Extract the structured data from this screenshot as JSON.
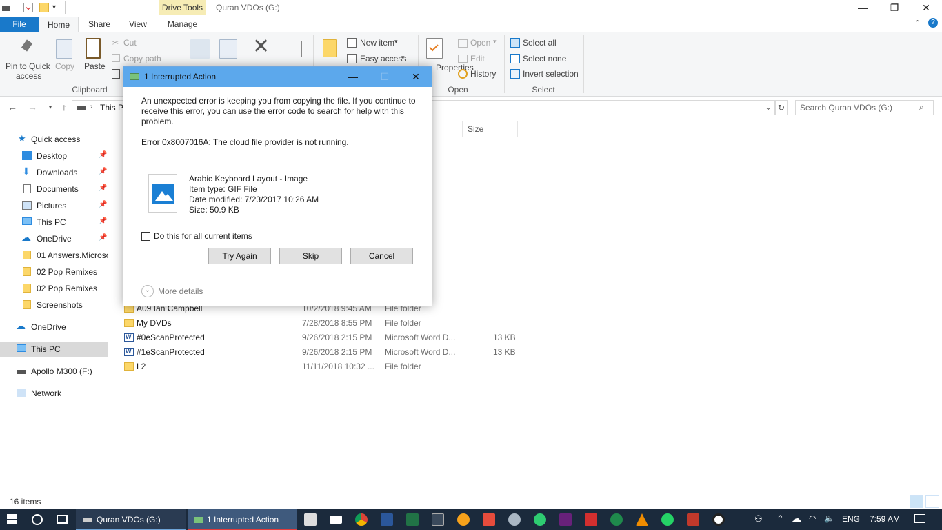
{
  "window": {
    "title": "Quran VDOs (G:)",
    "context_tab": "Drive Tools"
  },
  "tabs": [
    "File",
    "Home",
    "Share",
    "View",
    "Manage"
  ],
  "ribbon": {
    "clipboard": {
      "pin": "Pin to Quick",
      "pin2": "access",
      "copy": "Copy",
      "paste": "Paste",
      "cut": "Cut",
      "copy_path": "Copy path",
      "group": "Clipboard"
    },
    "organize": {
      "move": "Move",
      "copy": "Copy",
      "delete": "Delete",
      "rename": "Rename"
    },
    "new": {
      "new_folder": "New",
      "new_item": "New item",
      "easy_access": "Easy access"
    },
    "open": {
      "properties": "Properties",
      "open": "Open",
      "edit": "Edit",
      "history": "History",
      "group": "Open"
    },
    "select": {
      "select_all": "Select all",
      "select_none": "Select none",
      "invert": "Invert selection",
      "group": "Select"
    }
  },
  "address": {
    "path": "This P",
    "search_placeholder": "Search Quran VDOs (G:)"
  },
  "nav": {
    "quick_access": "Quick access",
    "items": [
      {
        "label": "Desktop"
      },
      {
        "label": "Downloads"
      },
      {
        "label": "Documents"
      },
      {
        "label": "Pictures"
      },
      {
        "label": "This PC"
      },
      {
        "label": "OneDrive"
      },
      {
        "label": "01 Answers.Microsc"
      },
      {
        "label": "02 Pop Remixes"
      },
      {
        "label": "02 Pop Remixes"
      },
      {
        "label": "Screenshots"
      }
    ],
    "onedrive": "OneDrive",
    "this_pc": "This PC",
    "apollo": "Apollo M300 (F:)",
    "network": "Network"
  },
  "filelist": {
    "col_size": "Size",
    "rows": [
      {
        "name": "A09 Ian Campbell",
        "date": "10/2/2018 9:45 AM",
        "type": "File folder",
        "size": ""
      },
      {
        "name": "My DVDs",
        "date": "7/28/2018 8:55 PM",
        "type": "File folder",
        "size": ""
      },
      {
        "name": "#0eScanProtected",
        "date": "9/26/2018 2:15 PM",
        "type": "Microsoft Word D...",
        "size": "13 KB"
      },
      {
        "name": "#1eScanProtected",
        "date": "9/26/2018 2:15 PM",
        "type": "Microsoft Word D...",
        "size": "13 KB"
      },
      {
        "name": "L2",
        "date": "11/11/2018 10:32 ...",
        "type": "File folder",
        "size": ""
      }
    ]
  },
  "status": {
    "items": "16 items"
  },
  "dialog": {
    "title": "1 Interrupted Action",
    "message": "An unexpected error is keeping you from copying the file. If you continue to receive this error, you can use the error code to search for help with this problem.",
    "error": "Error 0x8007016A: The cloud file provider is not running.",
    "file_name": "Arabic Keyboard Layout - Image",
    "file_type": "Item type: GIF File",
    "file_date": "Date modified: 7/23/2017 10:26 AM",
    "file_size": "Size: 50.9 KB",
    "checkbox_label": "Do this for all current items",
    "try_again": "Try Again",
    "skip": "Skip",
    "cancel": "Cancel",
    "more_details": "More details"
  },
  "taskbar": {
    "app1": "Quran VDOs (G:)",
    "app2": "1 Interrupted Action",
    "lang": "ENG",
    "time": "7:59 AM"
  },
  "colors": {
    "accent": "#1979ca",
    "dialog_title": "#5ca8ec",
    "taskbar": "#1b2a3c"
  }
}
